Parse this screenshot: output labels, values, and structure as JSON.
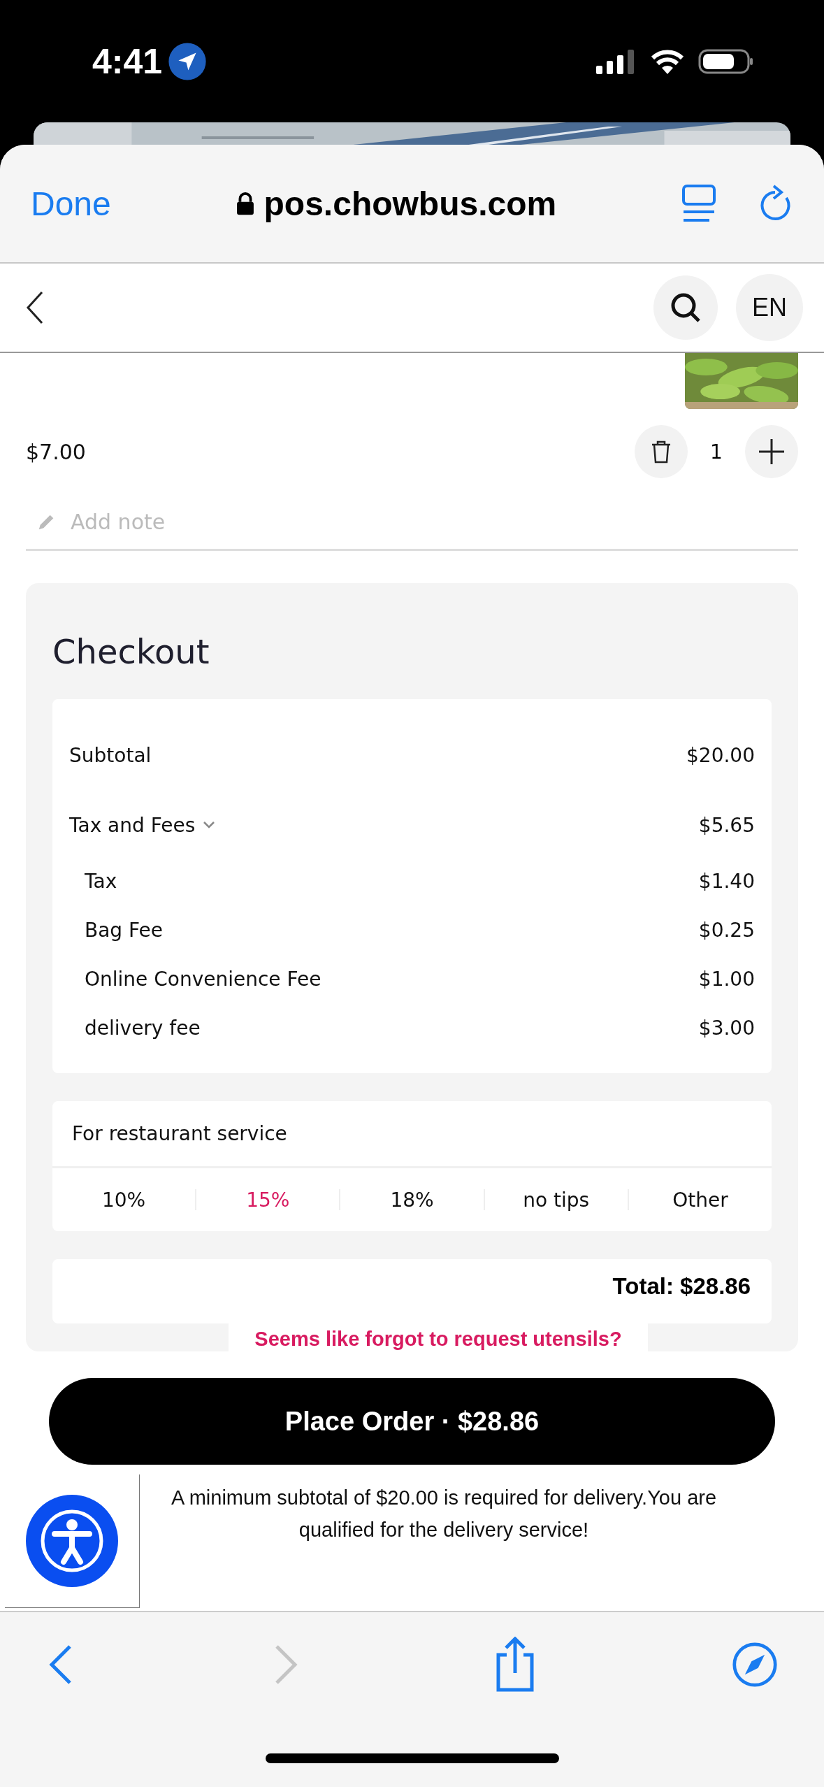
{
  "status_bar": {
    "time": "4:41"
  },
  "browser": {
    "done": "Done",
    "url": "pos.chowbus.com"
  },
  "nav": {
    "language": "EN"
  },
  "cart_item": {
    "price": "$7.00",
    "quantity": "1",
    "note_placeholder": "Add note"
  },
  "checkout": {
    "title": "Checkout",
    "rows": [
      {
        "label": "Subtotal",
        "amount": "$20.00"
      },
      {
        "label": "Tax and Fees",
        "amount": "$5.65",
        "expanded": true,
        "children": [
          {
            "label": "Tax",
            "amount": "$1.40"
          },
          {
            "label": "Bag Fee",
            "amount": "$0.25"
          },
          {
            "label": "Online Convenience Fee",
            "amount": "$1.00"
          },
          {
            "label": "delivery fee",
            "amount": "$3.00"
          }
        ]
      }
    ],
    "tips": {
      "label": "For restaurant service",
      "options": [
        {
          "label": "10%",
          "selected": false
        },
        {
          "label": "15%",
          "selected": true
        },
        {
          "label": "18%",
          "selected": false
        },
        {
          "label": "no tips",
          "selected": false
        },
        {
          "label": "Other",
          "selected": false
        }
      ]
    },
    "total": "Total: $28.86",
    "utensils_prompt": "Seems like forgot to request utensils?"
  },
  "place_order": "Place Order · $28.86",
  "delivery_note": "A minimum subtotal of $20.00 is required for delivery.You are qualified for the delivery service!",
  "toolbar": {
    "back": {
      "disabled": false
    },
    "forward": {
      "disabled": true
    }
  }
}
